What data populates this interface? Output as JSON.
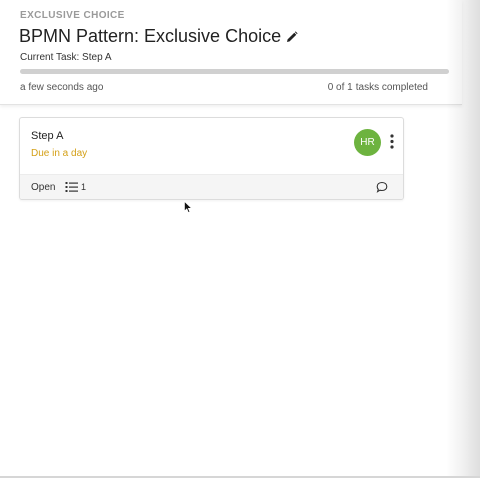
{
  "header": {
    "kicker": "EXCLUSIVE CHOICE",
    "title": "BPMN Pattern: Exclusive Choice",
    "current_task": "Current Task: Step A",
    "updated": "a few seconds ago",
    "tasks_done": "0 of 1",
    "tasks_suffix": "tasks completed",
    "progress": 0
  },
  "card": {
    "title": "Step A",
    "due": "Due in a day",
    "assignee_initials": "HR",
    "status": "Open",
    "checklist_count": "1"
  },
  "colors": {
    "avatar": "#6db33f",
    "due": "#d4a017"
  },
  "icons": [
    "edit-icon",
    "more-icon",
    "checklist-icon",
    "comment-icon"
  ]
}
